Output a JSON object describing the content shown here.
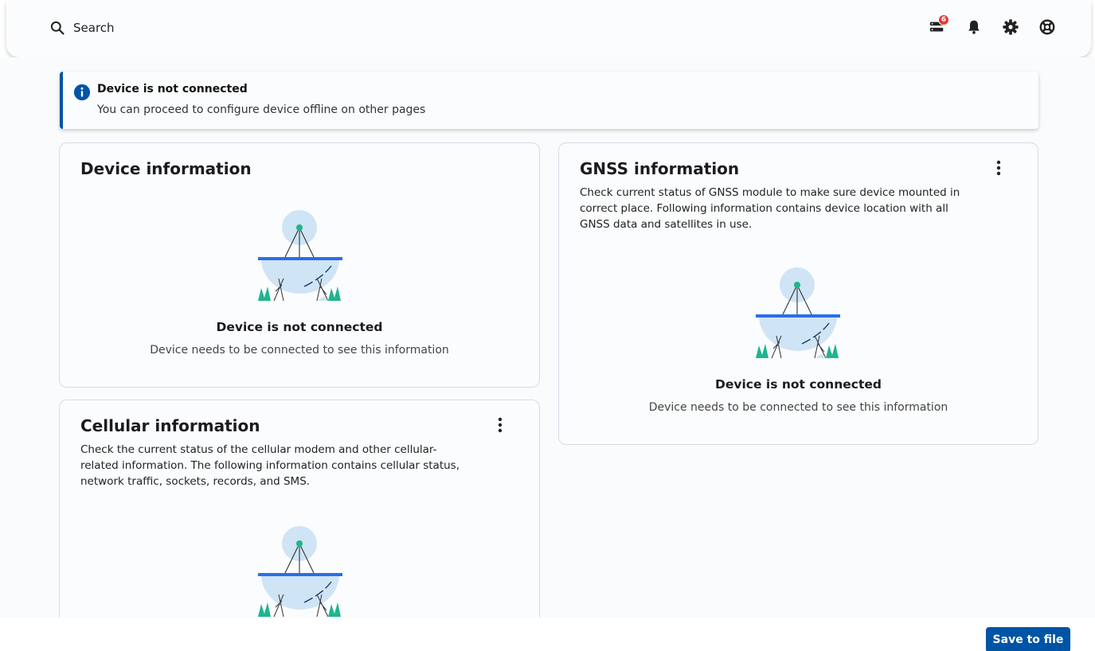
{
  "header": {
    "search_label": "Search",
    "notification_badge": "6",
    "icons": [
      "search-icon",
      "server-status-icon",
      "bell-icon",
      "gear-icon",
      "help-lifebuoy-icon"
    ]
  },
  "alert": {
    "title": "Device is not connected",
    "text": "You can proceed to configure device offline on other pages"
  },
  "cards": {
    "device": {
      "title": "Device information",
      "nc_title": "Device is not connected",
      "nc_text": "Device needs to be connected to see this information"
    },
    "gnss": {
      "title": "GNSS information",
      "description": "Check current status of GNSS module to make sure device mounted in correct place. Following information contains device location with all GNSS data and satellites in use.",
      "nc_title": "Device is not connected",
      "nc_text": "Device needs to be connected to see this information"
    },
    "cellular": {
      "title": "Cellular information",
      "description": "Check the current status of the cellular modem and other cellular-related information. The following information contains cellular status, network traffic, sockets, records, and SMS."
    }
  },
  "footer": {
    "save_label": "Save to file"
  },
  "colors": {
    "primary": "#0054a6",
    "badge": "#e53935",
    "illustration_blue": "#2b6de8",
    "illustration_light": "#cfe4f5",
    "illustration_green": "#1fb58f"
  }
}
